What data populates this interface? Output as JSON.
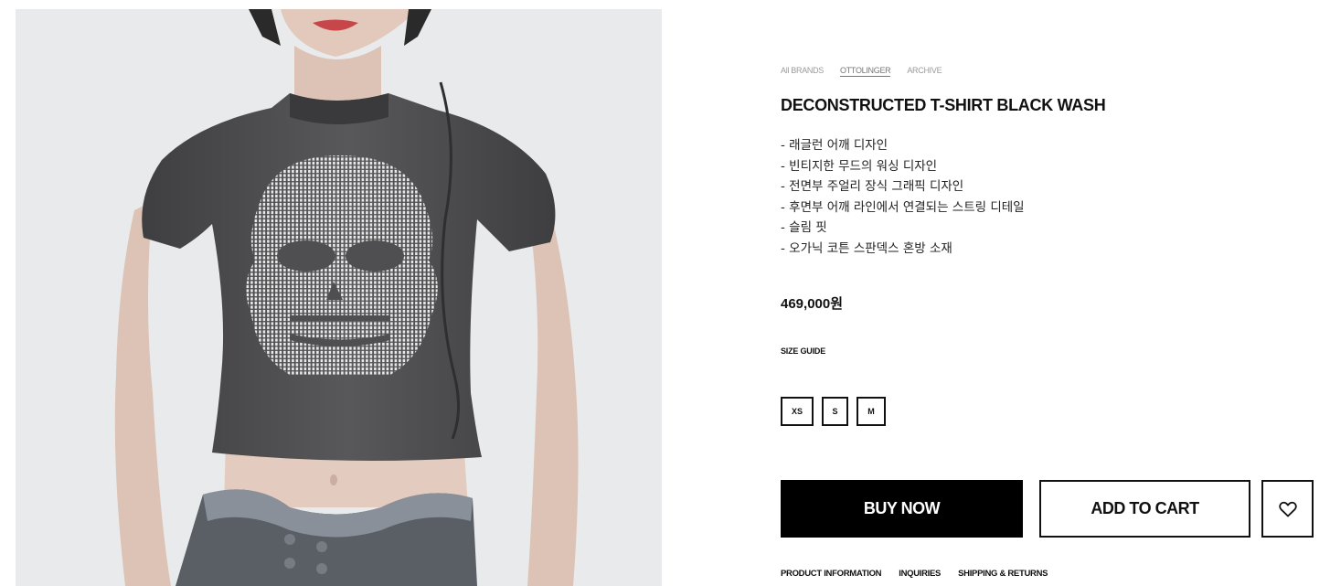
{
  "breadcrumb": {
    "items": [
      {
        "label": "All BRANDS"
      },
      {
        "label": "OTTOLINGER"
      },
      {
        "label": "ARCHIVE"
      }
    ]
  },
  "product": {
    "title": "DECONSTRUCTED T-SHIRT BLACK WASH",
    "description": [
      "- 래글런 어깨 디자인",
      "- 빈티지한 무드의 워싱 디자인",
      "- 전면부 주얼리 장식 그래픽 디자인",
      "- 후면부 어깨 라인에서 연결되는 스트링 디테일",
      "- 슬림 핏",
      "- 오가닉 코튼 스판덱스 혼방 소재"
    ],
    "price": "469,000원",
    "size_guide_label": "SIZE GUIDE",
    "sizes": [
      "XS",
      "S",
      "M"
    ]
  },
  "actions": {
    "buy_now_label": "BUY NOW",
    "add_to_cart_label": "ADD TO CART",
    "wishlist_icon": "heart-outline-icon"
  },
  "tabs": [
    {
      "label": "PRODUCT INFORMATION"
    },
    {
      "label": "INQUIRIES"
    },
    {
      "label": "SHIPPING & RETURNS"
    }
  ],
  "colors": {
    "accent": "#000000",
    "image_background": "#e9eaec",
    "shirt": "#4a4a4c",
    "muted_text": "#9a9a9a"
  }
}
